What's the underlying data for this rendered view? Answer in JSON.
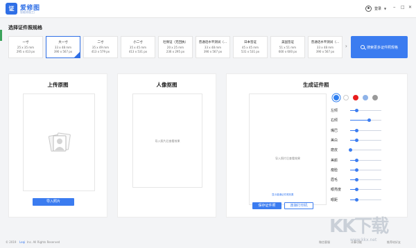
{
  "app": {
    "logo_glyph": "证",
    "name": "爱修图",
    "tagline": "智能修图工厂",
    "login": "登录"
  },
  "window": {
    "minimize": "–",
    "maximize": "□",
    "close": "✕"
  },
  "section_title": "选择证件照规格",
  "sizes": [
    {
      "name": "一寸",
      "mm": "25 x 35 mm",
      "px": "295 x 413 px",
      "selected": false
    },
    {
      "name": "大一寸",
      "mm": "33 x 48 mm",
      "px": "390 x 567 px",
      "selected": true
    },
    {
      "name": "二寸",
      "mm": "35 x 49 mm",
      "px": "413 x 579 px",
      "selected": false
    },
    {
      "name": "小二寸",
      "mm": "35 x 45 mm",
      "px": "413 x 531 px",
      "selected": false
    },
    {
      "name": "社保证（无回执）",
      "mm": "20 x 25 mm",
      "px": "236 x 295 px",
      "selected": false
    },
    {
      "name": "普通话水平测试（…",
      "mm": "33 x 48 mm",
      "px": "390 x 567 px",
      "selected": false
    },
    {
      "name": "日本签证",
      "mm": "45 x 45 mm",
      "px": "531 x 531 px",
      "selected": false
    },
    {
      "name": "美国签证",
      "mm": "51 x 51 mm",
      "px": "600 x 600 px",
      "selected": false
    },
    {
      "name": "普通话水平测试（…",
      "mm": "33 x 48 mm",
      "px": "390 x 567 px",
      "selected": false
    }
  ],
  "search_more": "搜索更多证件照规格",
  "panels": {
    "upload": {
      "title": "上传原图",
      "button": "导入照片"
    },
    "matting": {
      "title": "人像抠图",
      "hint": "导入照片后查看效果"
    },
    "generate": {
      "title": "生成证件照",
      "hint": "导入照片后查看效果",
      "link": "显示普通证件照效果",
      "save": "保存证件照",
      "print": "连接打印机"
    }
  },
  "bg_colors": [
    "#2f7ff0",
    "#ffffff",
    "#e81c1c",
    "#8fb3e8",
    "#9a9a9a"
  ],
  "sliders": [
    {
      "label": "左倾",
      "value": 0.2
    },
    {
      "label": "右倾",
      "value": 0.6
    },
    {
      "label": "嘴巴",
      "value": 0.2
    },
    {
      "label": "美白",
      "value": 0.2
    },
    {
      "label": "磨皮",
      "value": 0.0
    },
    {
      "label": "美颜",
      "value": 0.2
    },
    {
      "label": "瘦脸",
      "value": 0.2
    },
    {
      "label": "眉毛",
      "value": 0.2
    },
    {
      "label": "眼亮度",
      "value": 0.2
    },
    {
      "label": "眼距",
      "value": 0.2
    }
  ],
  "footer": {
    "copyright": "© 2019",
    "company": "Leqi",
    "rights": "Inc. All Rights Reserved",
    "links": [
      "微信客服",
      "计算功能",
      "推荐给好友"
    ]
  },
  "watermark": {
    "text": "KK下载",
    "url": "www.kkx.net"
  }
}
